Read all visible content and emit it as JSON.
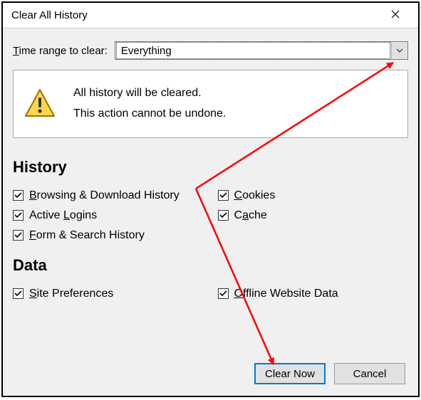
{
  "dialog": {
    "title": "Clear All History",
    "range_label_pre": "T",
    "range_label_mid": "ime range to clear:",
    "range_value": "Everything"
  },
  "warning": {
    "line1": "All history will be cleared.",
    "line2": "This action cannot be undone."
  },
  "sections": {
    "history_heading": "History",
    "data_heading": "Data"
  },
  "checks": {
    "browsing_u": "B",
    "browsing_rest": "rowsing & Download History",
    "active_pre": "Active ",
    "active_u": "L",
    "active_rest": "ogins",
    "form_u": "F",
    "form_rest": "orm & Search History",
    "cookies_u": "C",
    "cookies_rest": "ookies",
    "cache_pre": "C",
    "cache_u": "a",
    "cache_rest": "che",
    "site_u": "S",
    "site_rest": "ite Preferences",
    "offline_u": "O",
    "offline_rest": "ffline Website Data"
  },
  "buttons": {
    "clear_now": "Clear Now",
    "cancel": "Cancel"
  },
  "colors": {
    "accent": "#0078d7",
    "arrow": "#ff0000"
  }
}
